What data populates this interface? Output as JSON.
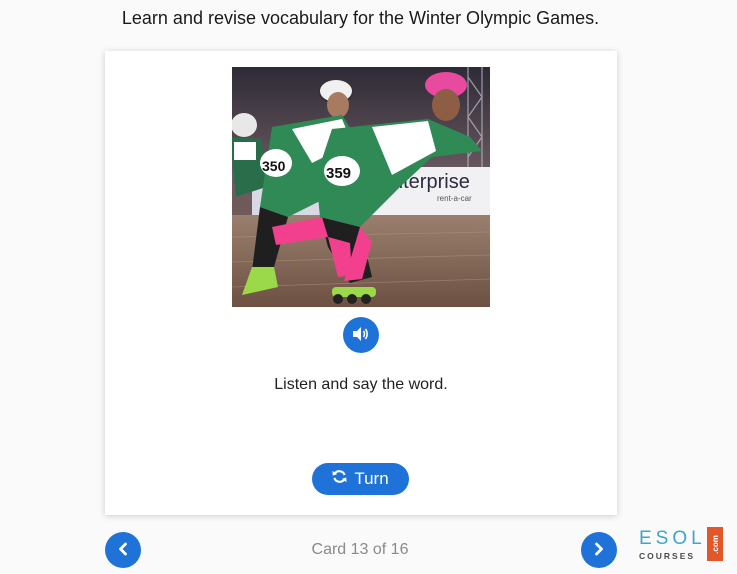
{
  "header": {
    "title": "Learn and revise vocabulary for the Winter Olympic Games."
  },
  "card": {
    "image": {
      "icon": "speed-skaters-photo",
      "banner_text": "nterprise",
      "banner_subtext": "rent-a-car",
      "bib_numbers": [
        "359",
        "350"
      ]
    },
    "audio_icon": "speaker-icon",
    "prompt": "Listen and say the word.",
    "turn_label": "Turn",
    "turn_icon": "refresh-icon"
  },
  "navigation": {
    "counter": "Card 13 of 16",
    "prev_icon": "chevron-left-icon",
    "next_icon": "chevron-right-icon"
  },
  "logo": {
    "line1": "ESOL",
    "line2": "COURSES",
    "badge": ".com"
  },
  "colors": {
    "accent": "#1f73d8",
    "logo_blue": "#3fa6c8",
    "logo_orange": "#e2572a"
  }
}
